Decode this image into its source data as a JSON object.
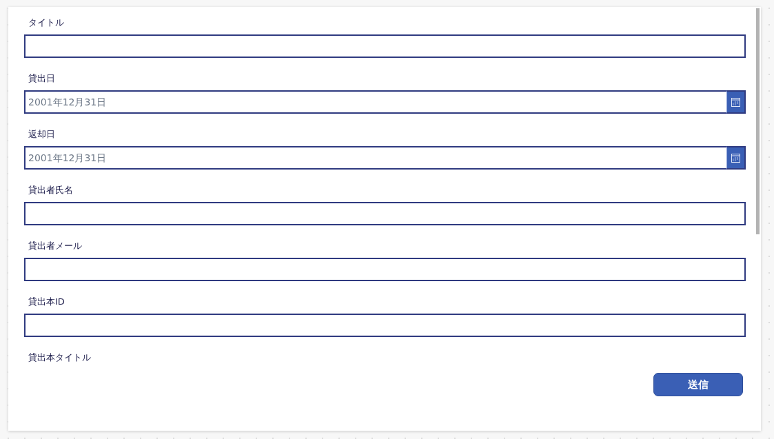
{
  "form": {
    "fields": [
      {
        "label": "タイトル",
        "kind": "text"
      },
      {
        "label": "貸出日",
        "kind": "date",
        "placeholder": "2001年12月31日"
      },
      {
        "label": "返却日",
        "kind": "date",
        "placeholder": "2001年12月31日"
      },
      {
        "label": "貸出者氏名",
        "kind": "text"
      },
      {
        "label": "貸出者メール",
        "kind": "text"
      },
      {
        "label": "貸出本ID",
        "kind": "text"
      },
      {
        "label": "貸出本タイトル",
        "kind": "label_only"
      }
    ],
    "submit_button": "送信"
  }
}
